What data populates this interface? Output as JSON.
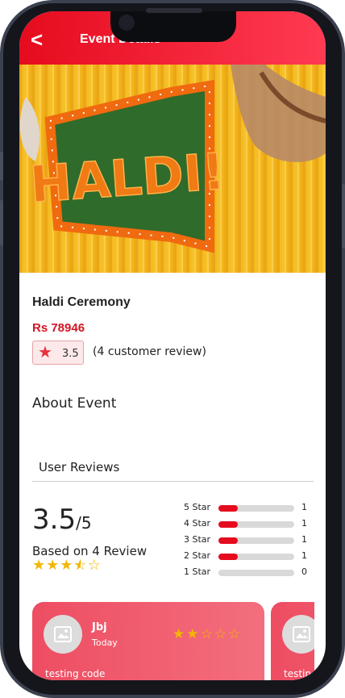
{
  "app_bar": {
    "back_glyph": "<",
    "title": "Event Details"
  },
  "event": {
    "title": "Haldi Ceremony",
    "price": "Rs 78946",
    "rating": "3.5",
    "review_count_text": "(4 customer review)",
    "about_heading": "About Event",
    "hero_sign_text": "HALDI!"
  },
  "reviews": {
    "heading": "User Reviews",
    "average": "3.5",
    "out_of": "/5",
    "based_on": "Based on 4 Review",
    "average_stars": 3.5,
    "distribution": [
      {
        "label": "5 Star",
        "count": "1",
        "fraction": 0.25
      },
      {
        "label": "4 Star",
        "count": "1",
        "fraction": 0.25
      },
      {
        "label": "3 Star",
        "count": "1",
        "fraction": 0.25
      },
      {
        "label": "2 Star",
        "count": "1",
        "fraction": 0.25
      },
      {
        "label": "1 Star",
        "count": "0",
        "fraction": 0.0
      }
    ],
    "cards": [
      {
        "name": "Jbj",
        "date": "Today",
        "stars": 2,
        "text": "testing code"
      },
      {
        "name": "",
        "date": "",
        "stars": 0,
        "text": "testin"
      }
    ]
  },
  "colors": {
    "accent": "#e60b1e",
    "card": "#f06074",
    "star": "#f2b705"
  }
}
